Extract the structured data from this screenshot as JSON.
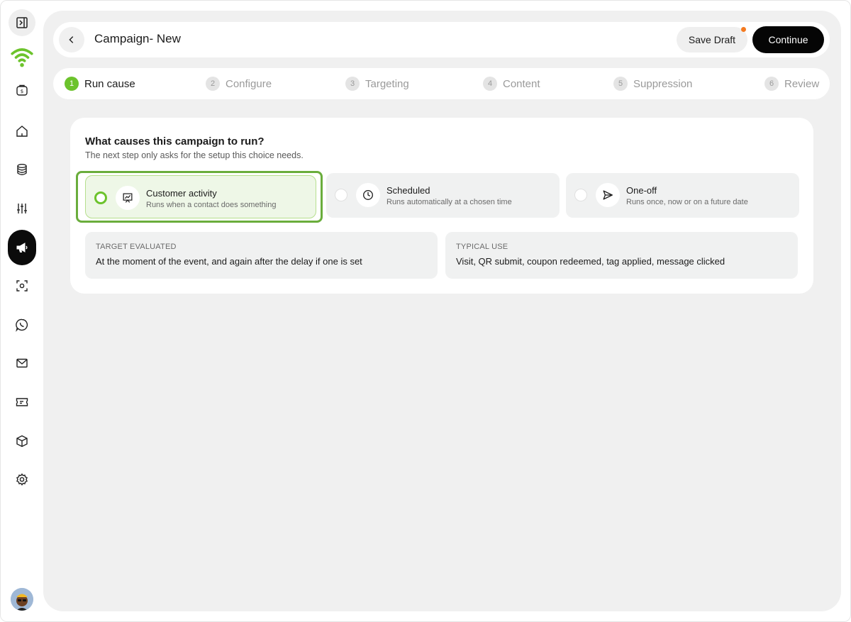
{
  "header": {
    "title": "Campaign- New",
    "save_draft_label": "Save Draft",
    "continue_label": "Continue"
  },
  "steps": [
    {
      "num": "1",
      "label": "Run cause",
      "active": true
    },
    {
      "num": "2",
      "label": "Configure",
      "active": false
    },
    {
      "num": "3",
      "label": "Targeting",
      "active": false
    },
    {
      "num": "4",
      "label": "Content",
      "active": false
    },
    {
      "num": "5",
      "label": "Suppression",
      "active": false
    },
    {
      "num": "6",
      "label": "Review",
      "active": false
    }
  ],
  "question": {
    "title": "What causes this campaign to run?",
    "subtitle": "The next step only asks for the setup this choice needs."
  },
  "options": [
    {
      "title": "Customer activity",
      "description": "Runs when a contact does something",
      "icon": "activity-chart-icon",
      "selected": true
    },
    {
      "title": "Scheduled",
      "description": "Runs automatically at a chosen time",
      "icon": "clock-icon",
      "selected": false
    },
    {
      "title": "One-off",
      "description": "Runs once, now or on a future date",
      "icon": "send-icon",
      "selected": false
    }
  ],
  "info": {
    "target_label": "TARGET EVALUATED",
    "target_value": "At the moment of the event, and again after the delay if one is set",
    "use_label": "TYPICAL USE",
    "use_value": "Visit, QR submit, coupon redeemed, tag applied, message clicked"
  },
  "sidebar": {
    "items": [
      "sidebar-toggle-icon",
      "wifi-logo-icon",
      "wallet-icon",
      "home-icon",
      "database-icon",
      "sliders-icon",
      "megaphone-icon",
      "scan-icon",
      "whatsapp-icon",
      "mail-icon",
      "ticket-icon",
      "box-icon",
      "gear-icon"
    ],
    "active": "megaphone-icon"
  },
  "colors": {
    "accent": "#6cc32c",
    "selected_ring": "#6aad3c",
    "draft_dot": "#f47a20",
    "primary_button": "#050505"
  }
}
